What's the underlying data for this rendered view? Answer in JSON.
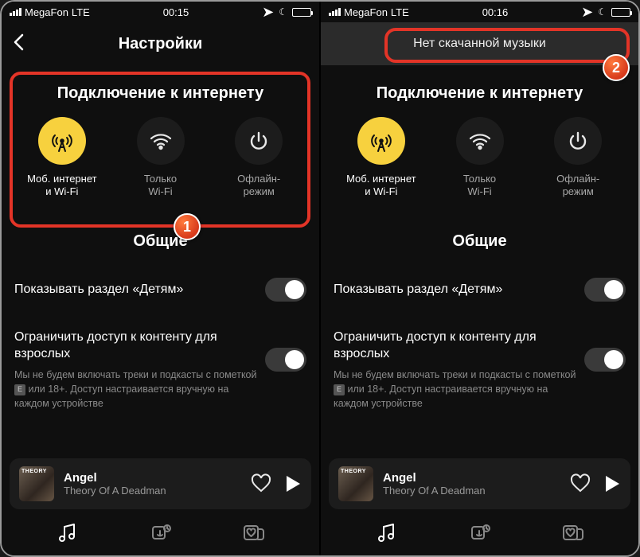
{
  "left": {
    "status": {
      "carrier": "MegaFon",
      "network": "LTE",
      "time": "00:15"
    },
    "header": {
      "title": "Настройки"
    },
    "connection": {
      "title": "Подключение к интернету",
      "items": [
        {
          "line1": "Моб. интернет",
          "line2": "и Wi-Fi"
        },
        {
          "line1": "Только",
          "line2": "Wi-Fi"
        },
        {
          "line1": "Офлайн-",
          "line2": "режим"
        }
      ]
    },
    "general": {
      "title": "Общие",
      "kids_label": "Показывать раздел «Детям»",
      "adult_label": "Ограничить доступ к контенту для взрослых",
      "adult_sub_a": "Мы не будем включать треки и подкасты с пометкой ",
      "adult_sub_b": " или 18+. Доступ настраивается вручную на каждом устройстве",
      "adult_badge": "E"
    },
    "player": {
      "title": "Angel",
      "artist": "Theory Of A Deadman"
    },
    "badge": "1"
  },
  "right": {
    "status": {
      "carrier": "MegaFon",
      "network": "LTE",
      "time": "00:16"
    },
    "toast": "Нет скачанной музыки",
    "connection": {
      "title": "Подключение к интернету",
      "items": [
        {
          "line1": "Моб. интернет",
          "line2": "и Wi-Fi"
        },
        {
          "line1": "Только",
          "line2": "Wi-Fi"
        },
        {
          "line1": "Офлайн-",
          "line2": "режим"
        }
      ]
    },
    "general": {
      "title": "Общие",
      "kids_label": "Показывать раздел «Детям»",
      "adult_label": "Ограничить доступ к контенту для взрослых",
      "adult_sub_a": "Мы не будем включать треки и подкасты с пометкой ",
      "adult_sub_b": " или 18+. Доступ настраивается вручную на каждом устройстве",
      "adult_badge": "E"
    },
    "player": {
      "title": "Angel",
      "artist": "Theory Of A Deadman"
    },
    "badge": "2"
  }
}
